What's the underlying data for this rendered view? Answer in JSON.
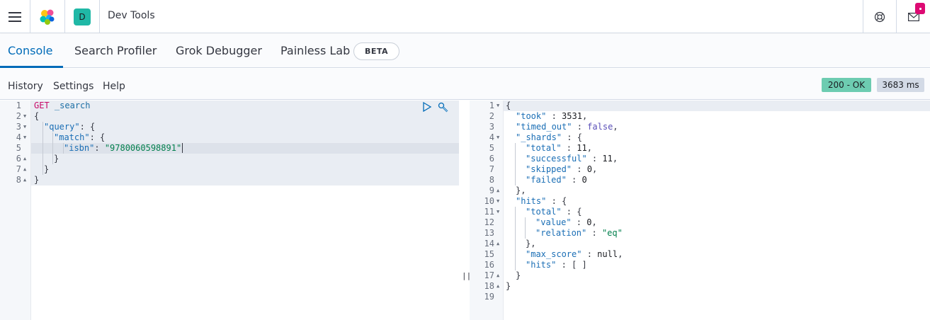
{
  "header": {
    "title": "Dev Tools",
    "space_initial": "D",
    "icons": {
      "menu": "hamburger-menu-icon",
      "logo": "elastic-logo-icon",
      "help": "help-icon",
      "mail": "newsfeed-icon"
    }
  },
  "tabs": [
    {
      "label": "Console",
      "active": true
    },
    {
      "label": "Search Profiler",
      "active": false
    },
    {
      "label": "Grok Debugger",
      "active": false
    },
    {
      "label": "Painless Lab",
      "active": false
    }
  ],
  "beta_label": "BETA",
  "nav": {
    "history": "History",
    "settings": "Settings",
    "help": "Help"
  },
  "status": {
    "code": "200 - OK",
    "time": "3683 ms"
  },
  "colors": {
    "accent": "#006bb8",
    "status_ok": "#6dccb1",
    "space_badge": "#20b8a6",
    "notification": "#dd0a73"
  },
  "request_editor": {
    "line_numbers": [
      "1",
      "2",
      "3",
      "4",
      "5",
      "6",
      "7",
      "8"
    ],
    "lines": {
      "l1_method": "GET",
      "l1_path": "_search",
      "l2": "{",
      "l3_key": "\"query\"",
      "l3_rest": ": {",
      "l4_key": "\"match\"",
      "l4_rest": ": {",
      "l5_key": "\"isbn\"",
      "l5_colon": ": ",
      "l5_val": "\"9780060598891\"",
      "l6": "}",
      "l7": "}",
      "l8": "}"
    }
  },
  "response_editor": {
    "line_numbers": [
      "1",
      "2",
      "3",
      "4",
      "5",
      "6",
      "7",
      "8",
      "9",
      "10",
      "11",
      "12",
      "13",
      "14",
      "15",
      "16",
      "17",
      "18",
      "19"
    ],
    "lines": {
      "l1": "{",
      "l2_key": "\"took\"",
      "l2_val": "3531",
      "l3_key": "\"timed_out\"",
      "l3_val": "false",
      "l4_key": "\"_shards\"",
      "l5_key": "\"total\"",
      "l5_val": "11",
      "l6_key": "\"successful\"",
      "l6_val": "11",
      "l7_key": "\"skipped\"",
      "l7_val": "0",
      "l8_key": "\"failed\"",
      "l8_val": "0",
      "l9": "},",
      "l10_key": "\"hits\"",
      "l11_key": "\"total\"",
      "l12_key": "\"value\"",
      "l12_val": "0",
      "l13_key": "\"relation\"",
      "l13_val": "\"eq\"",
      "l14": "},",
      "l15_key": "\"max_score\"",
      "l15_val": "null",
      "l16_key": "\"hits\"",
      "l16_val": "[ ]",
      "l17": "}",
      "l18": "}"
    }
  },
  "splitter_glyph": "||"
}
